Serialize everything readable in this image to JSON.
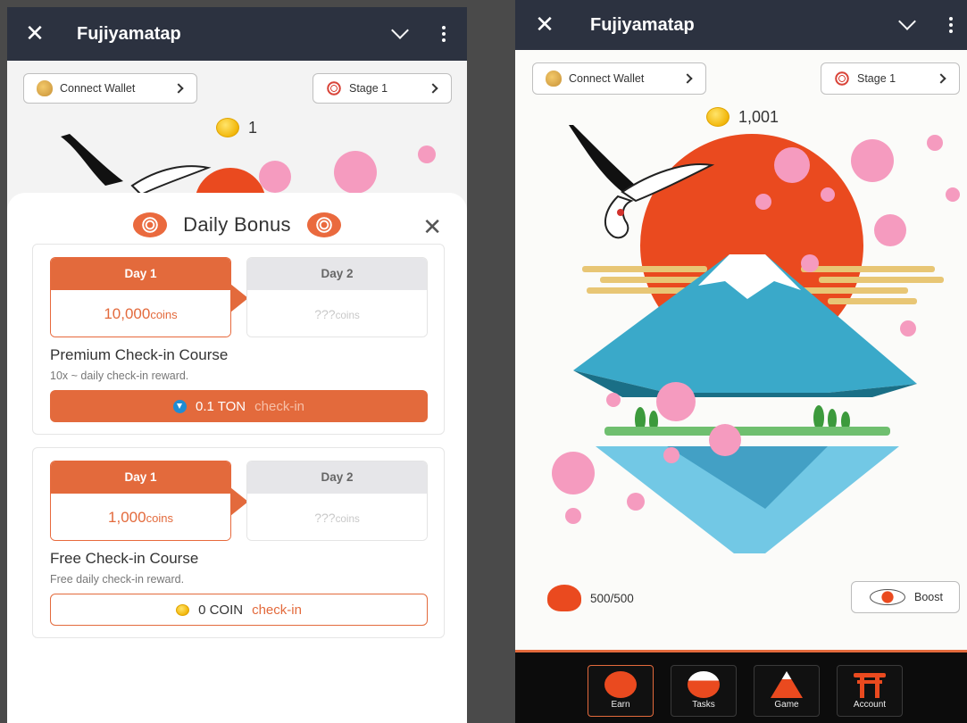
{
  "app": {
    "title": "Fujiyamatap"
  },
  "left_screen": {
    "connect_wallet": "Connect Wallet",
    "stage": "Stage 1",
    "coin_count": "1",
    "daily_bonus": {
      "title": "Daily Bonus",
      "premium": {
        "day1_label": "Day 1",
        "day1_value": "10,000",
        "day1_unit": "coins",
        "day2_label": "Day 2",
        "day2_value": "???",
        "day2_unit": "coins",
        "course_title": "Premium Check-in Course",
        "course_desc": "10x ~ daily check-in reward.",
        "button_amount": "0.1 TON",
        "button_action": "check-in"
      },
      "free": {
        "day1_label": "Day 1",
        "day1_value": "1,000",
        "day1_unit": "coins",
        "day2_label": "Day 2",
        "day2_value": "???",
        "day2_unit": "coins",
        "course_title": "Free Check-in Course",
        "course_desc": "Free daily check-in reward.",
        "button_amount": "0 COIN",
        "button_action": "check-in"
      }
    }
  },
  "right_screen": {
    "connect_wallet": "Connect Wallet",
    "stage": "Stage 1",
    "coin_count": "1,001",
    "energy": "500/500",
    "boost": "Boost",
    "nav": [
      {
        "label": "Earn",
        "icon": "earn-icon"
      },
      {
        "label": "Tasks",
        "icon": "tasks-icon"
      },
      {
        "label": "Game",
        "icon": "game-icon"
      },
      {
        "label": "Account",
        "icon": "torii-icon"
      }
    ]
  },
  "colors": {
    "accent": "#e36a3c",
    "appbar": "#2c3240",
    "sun": "#ea4a1f",
    "mountain": "#3aa9c9",
    "sakura": "#f59bbf"
  }
}
